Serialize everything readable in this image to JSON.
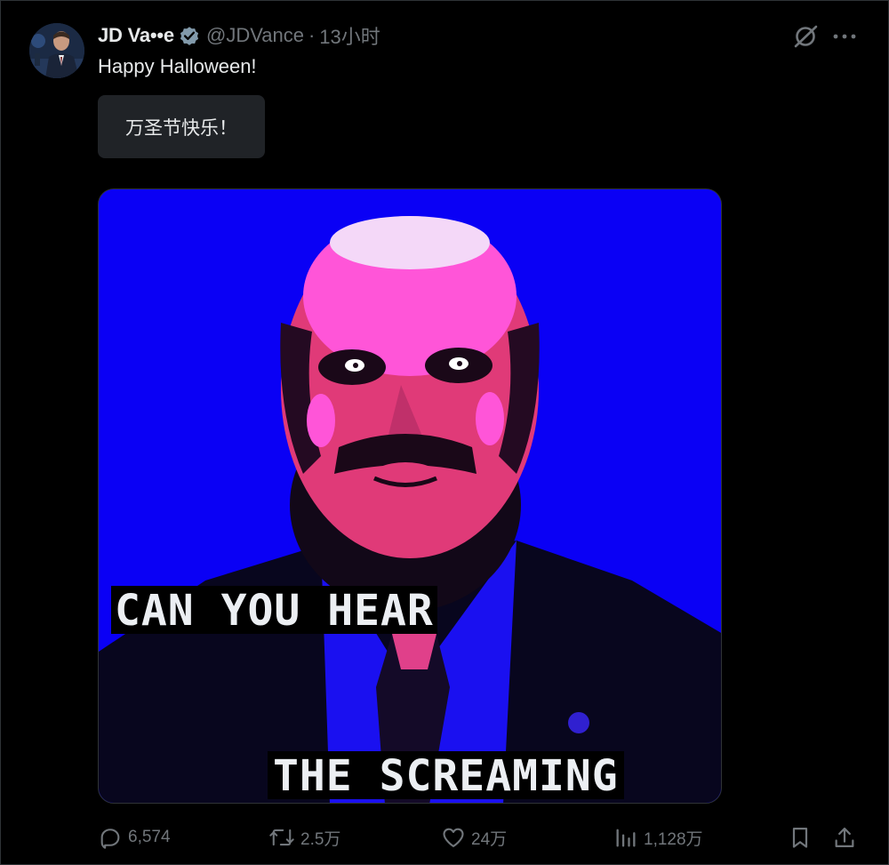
{
  "tweet": {
    "display_name": "JD Va••e",
    "handle": "@JDVance",
    "separator": "·",
    "time": "13小时",
    "text": "Happy Halloween!",
    "translation": "万圣节快乐！",
    "verified_icon": "verified-badge-icon",
    "colors": {
      "background": "#000000",
      "text": "#e7e9ea",
      "muted": "#71767b",
      "translation_bg": "#202327",
      "media_bg": "#0a00f5"
    }
  },
  "media": {
    "caption_line1": "CAN YOU HEAR",
    "caption_line2": "THE SCREAMING"
  },
  "actions": {
    "replies": "6,574",
    "reposts": "2.5万",
    "likes": "24万",
    "views": "1,128万",
    "icons": [
      "reply-icon",
      "repost-icon",
      "like-icon",
      "views-icon",
      "bookmark-icon",
      "share-icon"
    ]
  },
  "top_icons": [
    "grok-icon",
    "more-icon"
  ]
}
